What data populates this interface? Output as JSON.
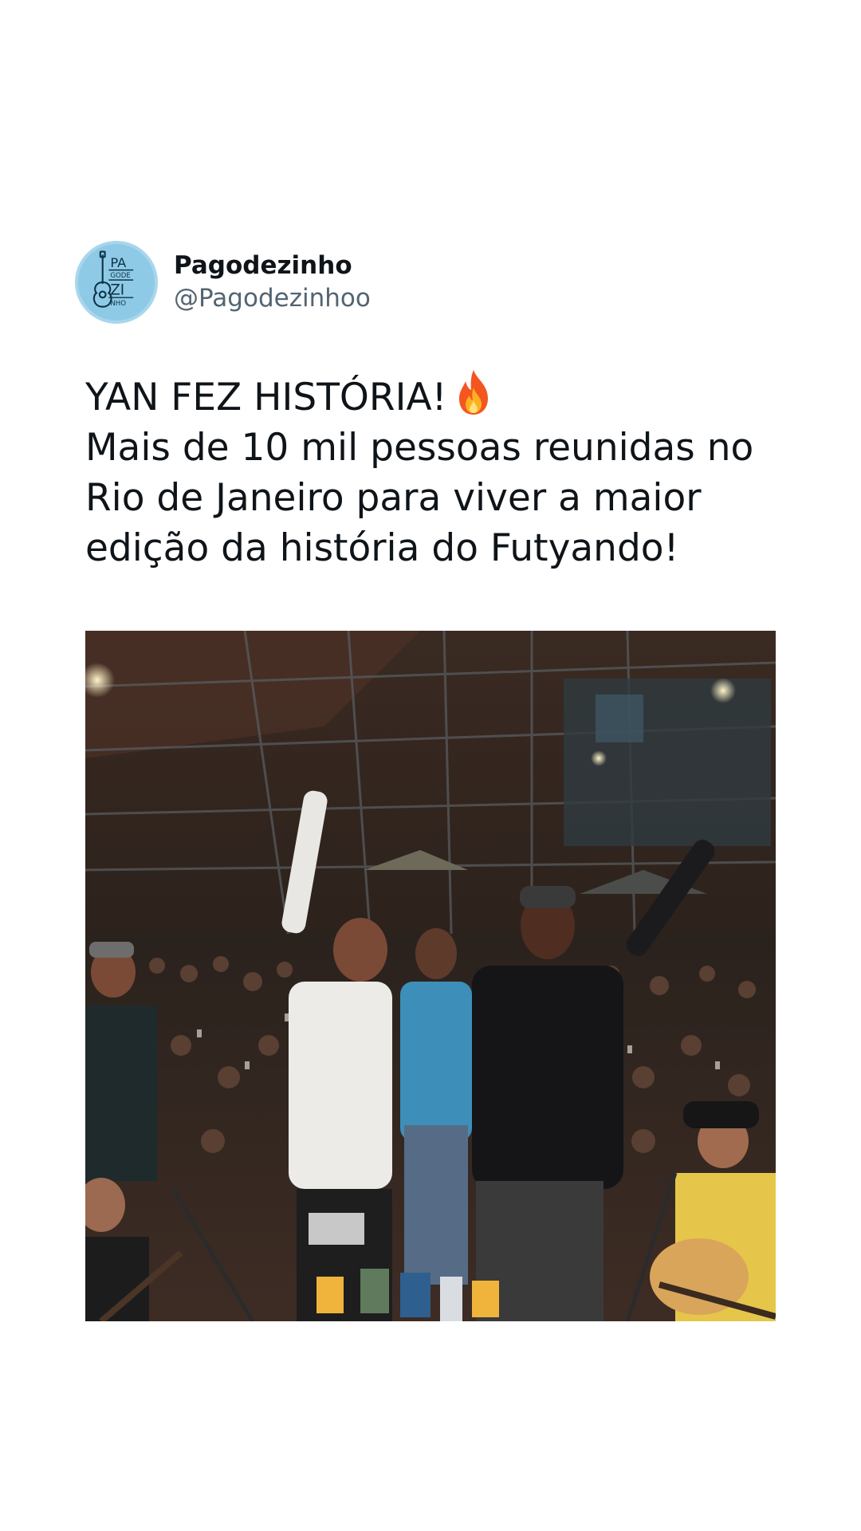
{
  "post": {
    "author": {
      "display_name": "Pagodezinho",
      "handle": "@Pagodezinhoo",
      "avatar": {
        "logo_text": [
          "PA",
          "GODE",
          "ZI",
          "NHO"
        ],
        "background_color": "#8ecae6",
        "ink_color": "#0e3346"
      }
    },
    "text": {
      "line1": "YAN FEZ HISTÓRIA!",
      "line1_emoji": "fire-icon",
      "line2": "Mais de 10 mil pessoas reunidas no",
      "line3": "Rio de Janeiro para viver a maior",
      "line4": "edição da história do Futyando!"
    },
    "photo": {
      "subject": "photo-concert-stage-crowd"
    }
  },
  "colors": {
    "background": "#ffffff",
    "text_primary": "#0f1419",
    "text_secondary": "#536471"
  }
}
